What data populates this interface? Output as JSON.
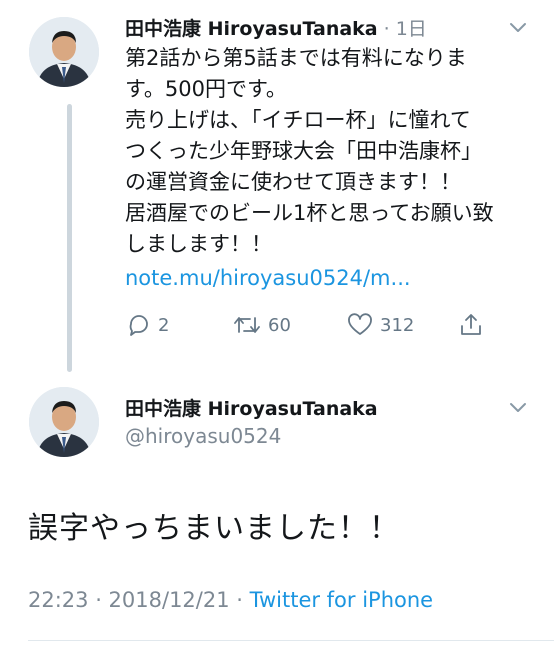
{
  "reply_tweet": {
    "display_name": "田中浩康 HiroyasuTanaka",
    "time_sep": "·",
    "relative_time": "1日",
    "lines": [
      "第2話から第5話までは有料になりま",
      "す。500円です。",
      "売り上げは、「イチロー杯」に憧れて",
      "つくった少年野球大会「田中浩康杯」",
      "の運営資金に使わせて頂きます！！",
      "居酒屋でのビール1杯と思ってお願い致",
      "しまします！！"
    ],
    "link": "note.mu/hiroyasu0524/m...",
    "actions": {
      "replies": "2",
      "retweets": "60",
      "likes": "312"
    }
  },
  "main_tweet": {
    "display_name": "田中浩康 HiroyasuTanaka",
    "handle": "@hiroyasu0524",
    "text": "誤字やっちまいました！！",
    "timestamp": "22:23 · 2018/12/21 · ",
    "source": "Twitter for iPhone"
  },
  "icons": {
    "avatar": "profile-photo",
    "menu": "chevron-down-icon",
    "reply": "reply-icon",
    "retweet": "retweet-icon",
    "like": "heart-icon",
    "share": "share-icon"
  },
  "colors": {
    "link": "#1b95e0",
    "muted": "#7d8893",
    "thread_line": "#cdd6dd"
  }
}
